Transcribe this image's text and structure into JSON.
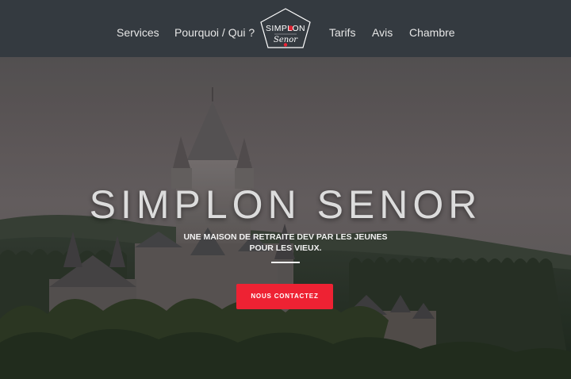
{
  "nav": {
    "links": [
      "Services",
      "Pourquoi / Qui ?",
      "Tarifs",
      "Avis",
      "Chambre"
    ],
    "logo_top": "SIMPLON",
    "logo_bottom": "Senor"
  },
  "hero": {
    "title": "SIMPLON SENOR",
    "subtitle_line1": "UNE MAISON DE RETRAITE DEV PAR LES JEUNES",
    "subtitle_line2": "POUR LES VIEUX.",
    "cta_label": "NOUS CONTACTEZ"
  },
  "colors": {
    "nav_bg": "#343a40",
    "accent": "#ee2233",
    "text": "#e6e6e6"
  }
}
